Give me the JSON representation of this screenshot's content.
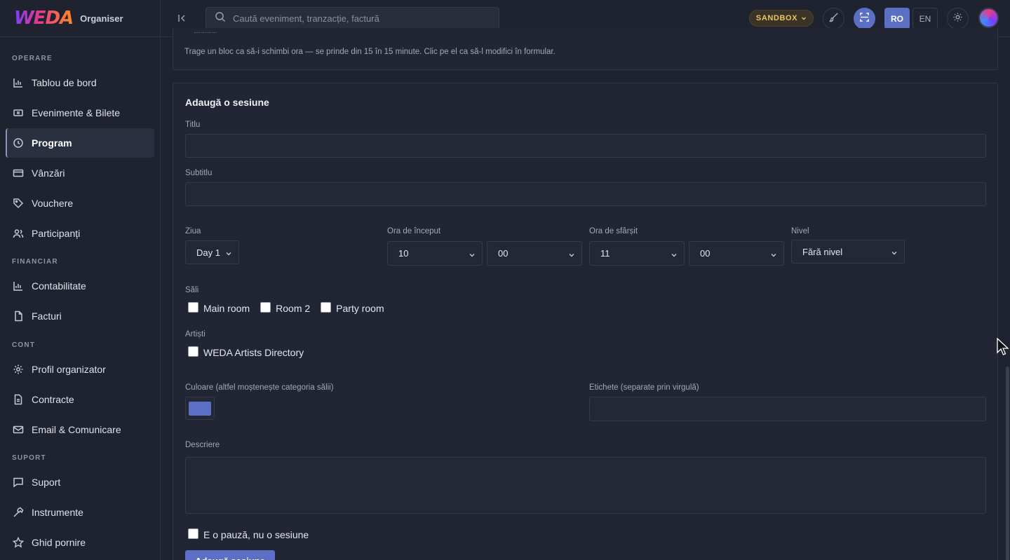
{
  "brand": {
    "logo": "WEDA",
    "subtitle": "Organiser"
  },
  "sidebar": {
    "sections": [
      {
        "label": "OPERARE"
      },
      {
        "label": "FINANCIAR"
      },
      {
        "label": "CONT"
      },
      {
        "label": "SUPORT"
      }
    ],
    "items": [
      {
        "label": "Tablou de bord",
        "icon": "bar-chart-icon"
      },
      {
        "label": "Evenimente & Bilete",
        "icon": "ticket-icon"
      },
      {
        "label": "Program",
        "icon": "clock-icon",
        "active": true
      },
      {
        "label": "Vânzări",
        "icon": "credit-card-icon"
      },
      {
        "label": "Vouchere",
        "icon": "tag-icon"
      },
      {
        "label": "Participanți",
        "icon": "users-icon"
      },
      {
        "label": "Contabilitate",
        "icon": "bar-chart-icon"
      },
      {
        "label": "Facturi",
        "icon": "document-icon"
      },
      {
        "label": "Profil organizator",
        "icon": "gear-icon"
      },
      {
        "label": "Contracte",
        "icon": "document-icon"
      },
      {
        "label": "Email & Comunicare",
        "icon": "mail-icon"
      },
      {
        "label": "Suport",
        "icon": "chat-icon"
      },
      {
        "label": "Instrumente",
        "icon": "hammer-icon"
      },
      {
        "label": "Ghid pornire",
        "icon": "star-icon"
      }
    ]
  },
  "topbar": {
    "search_placeholder": "Caută eveniment, tranzacție, factură",
    "sandbox_label": "SANDBOX",
    "lang_ro": "RO",
    "lang_en": "EN"
  },
  "schedule_hint": "Trage un bloc ca să-i schimbi ora — se prinde din 15 în 15 minute. Clic pe el ca să-l modifici în formular.",
  "form": {
    "title": "Adaugă o sesiune",
    "title_label": "Titlu",
    "title_value": "",
    "subtitle_label": "Subtitlu",
    "subtitle_value": "",
    "day_label": "Ziua",
    "day_value": "Day 1",
    "start_label": "Ora de început",
    "start_hour": "10",
    "start_minute": "00",
    "end_label": "Ora de sfârșit",
    "end_hour": "11",
    "end_minute": "00",
    "level_label": "Nivel",
    "level_value": "Fără nivel",
    "rooms_label": "Săli",
    "rooms": [
      "Main room",
      "Room 2",
      "Party room"
    ],
    "artists_label": "Artiști",
    "artists": [
      "WEDA Artists Directory"
    ],
    "color_label": "Culoare (altfel moștenește categoria sălii)",
    "color_value": "#5b6fc4",
    "tags_label": "Etichete (separate prin virgulă)",
    "tags_value": "",
    "description_label": "Descriere",
    "description_value": "",
    "pause_label": "E o pauză, nu o sesiune",
    "submit_label": "Adaugă sesiune"
  },
  "colors": {
    "accent": "#5b6fc4",
    "sandbox": "#e9c46a",
    "background": "#1f2330"
  }
}
